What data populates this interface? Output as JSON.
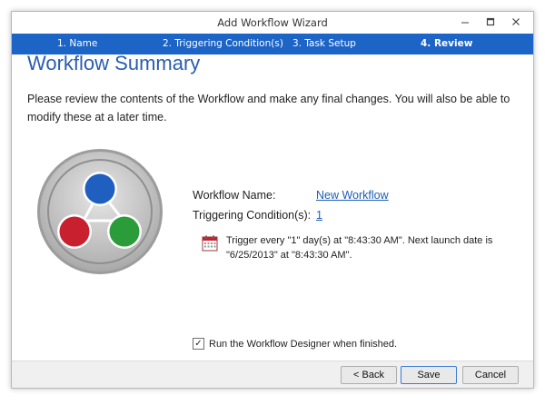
{
  "window": {
    "title": "Add Workflow Wizard"
  },
  "steps": [
    {
      "label": "1.  Name"
    },
    {
      "label": "2.  Triggering Condition(s)"
    },
    {
      "label": "3.  Task Setup"
    },
    {
      "label": "4.  Review",
      "active": true
    }
  ],
  "main": {
    "heading": "Workflow Summary",
    "description": "Please review the contents of the Workflow and make any final changes.  You will also be able to modify these at a later time.",
    "workflow_name_label": "Workflow Name:",
    "workflow_name_value": "New Workflow",
    "triggering_label": "Triggering Condition(s):",
    "triggering_value": "1",
    "trigger_description": "Trigger every \"1\" day(s) at \"8:43:30 AM\". Next launch date is \"6/25/2013\" at \"8:43:30 AM\".",
    "run_designer_label": "Run the Workflow Designer when finished.",
    "run_designer_checked": true
  },
  "footer": {
    "back": "< Back",
    "save": "Save",
    "cancel": "Cancel"
  },
  "icons": {
    "minimize": "minimize-icon",
    "maximize": "maximize-icon",
    "close": "close-icon",
    "calendar": "calendar-icon",
    "logo": "workflow-logo-icon"
  },
  "colors": {
    "accent": "#1c64c6",
    "node_blue": "#1e5fbf",
    "node_red": "#c8202e",
    "node_green": "#2a9d3a"
  }
}
